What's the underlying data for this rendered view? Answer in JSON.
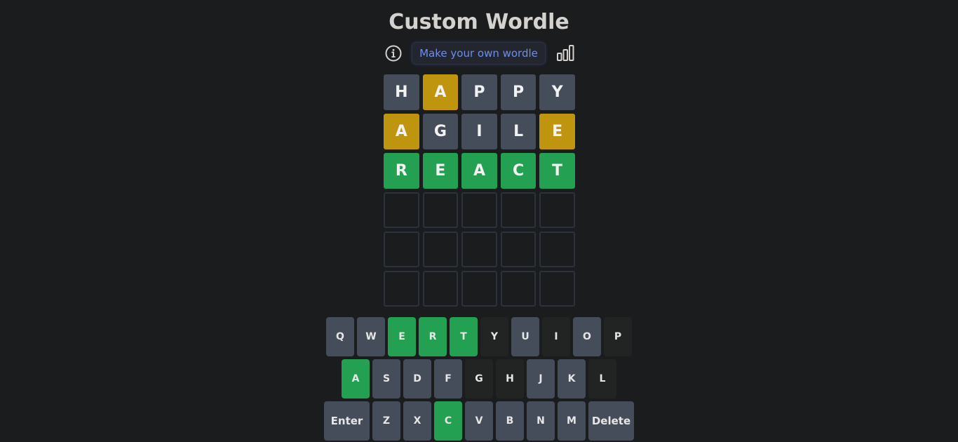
{
  "header": {
    "title": "Custom Wordle",
    "make_button_label": "Make your own wordle"
  },
  "board": {
    "rows": [
      [
        {
          "letter": "H",
          "state": "absent"
        },
        {
          "letter": "A",
          "state": "present"
        },
        {
          "letter": "P",
          "state": "absent"
        },
        {
          "letter": "P",
          "state": "absent"
        },
        {
          "letter": "Y",
          "state": "absent"
        }
      ],
      [
        {
          "letter": "A",
          "state": "present"
        },
        {
          "letter": "G",
          "state": "absent"
        },
        {
          "letter": "I",
          "state": "absent"
        },
        {
          "letter": "L",
          "state": "absent"
        },
        {
          "letter": "E",
          "state": "present"
        }
      ],
      [
        {
          "letter": "R",
          "state": "correct"
        },
        {
          "letter": "E",
          "state": "correct"
        },
        {
          "letter": "A",
          "state": "correct"
        },
        {
          "letter": "C",
          "state": "correct"
        },
        {
          "letter": "T",
          "state": "correct"
        }
      ],
      [
        {
          "letter": "",
          "state": "empty"
        },
        {
          "letter": "",
          "state": "empty"
        },
        {
          "letter": "",
          "state": "empty"
        },
        {
          "letter": "",
          "state": "empty"
        },
        {
          "letter": "",
          "state": "empty"
        }
      ],
      [
        {
          "letter": "",
          "state": "empty"
        },
        {
          "letter": "",
          "state": "empty"
        },
        {
          "letter": "",
          "state": "empty"
        },
        {
          "letter": "",
          "state": "empty"
        },
        {
          "letter": "",
          "state": "empty"
        }
      ],
      [
        {
          "letter": "",
          "state": "empty"
        },
        {
          "letter": "",
          "state": "empty"
        },
        {
          "letter": "",
          "state": "empty"
        },
        {
          "letter": "",
          "state": "empty"
        },
        {
          "letter": "",
          "state": "empty"
        }
      ]
    ]
  },
  "keyboard": {
    "rows": [
      [
        {
          "label": "Q",
          "state": "unused"
        },
        {
          "label": "W",
          "state": "unused"
        },
        {
          "label": "E",
          "state": "correct"
        },
        {
          "label": "R",
          "state": "correct"
        },
        {
          "label": "T",
          "state": "correct"
        },
        {
          "label": "Y",
          "state": "absent"
        },
        {
          "label": "U",
          "state": "unused"
        },
        {
          "label": "I",
          "state": "absent"
        },
        {
          "label": "O",
          "state": "unused"
        },
        {
          "label": "P",
          "state": "absent"
        }
      ],
      [
        {
          "label": "A",
          "state": "correct"
        },
        {
          "label": "S",
          "state": "unused"
        },
        {
          "label": "D",
          "state": "unused"
        },
        {
          "label": "F",
          "state": "unused"
        },
        {
          "label": "G",
          "state": "absent"
        },
        {
          "label": "H",
          "state": "absent"
        },
        {
          "label": "J",
          "state": "unused"
        },
        {
          "label": "K",
          "state": "unused"
        },
        {
          "label": "L",
          "state": "absent"
        }
      ],
      [
        {
          "label": "Enter",
          "state": "unused",
          "wide": true
        },
        {
          "label": "Z",
          "state": "unused"
        },
        {
          "label": "X",
          "state": "unused"
        },
        {
          "label": "C",
          "state": "correct"
        },
        {
          "label": "V",
          "state": "unused"
        },
        {
          "label": "B",
          "state": "unused"
        },
        {
          "label": "N",
          "state": "unused"
        },
        {
          "label": "M",
          "state": "unused"
        },
        {
          "label": "Delete",
          "state": "unused",
          "wide": true
        }
      ]
    ]
  },
  "colors": {
    "background": "#1b1c1e",
    "absent_tile": "#454c5a",
    "present": "#bf9510",
    "correct": "#24a052",
    "absent_key": "#222323",
    "link": "#6d8fe8"
  },
  "icons": {
    "info": "info-circle-icon",
    "stats": "bar-chart-icon"
  }
}
